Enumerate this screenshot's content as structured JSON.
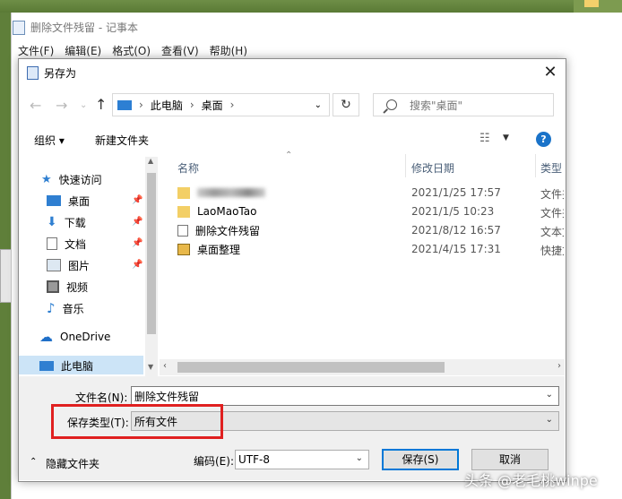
{
  "notepad": {
    "title": "删除文件残留 - 记事本",
    "menu": [
      "文件(F)",
      "编辑(E)",
      "格式(O)",
      "查看(V)",
      "帮助(H)"
    ]
  },
  "dialog": {
    "title": "另存为",
    "address": {
      "segments": [
        "此电脑",
        "桌面"
      ]
    },
    "search_placeholder": "搜索\"桌面\"",
    "toolbar": {
      "organize": "组织 ▾",
      "new_folder": "新建文件夹"
    },
    "nav": [
      {
        "label": "快速访问",
        "icon": "star-icon"
      },
      {
        "label": "桌面",
        "icon": "desktop-icon",
        "pinned": true
      },
      {
        "label": "下载",
        "icon": "download-icon",
        "pinned": true
      },
      {
        "label": "文档",
        "icon": "document-icon",
        "pinned": true
      },
      {
        "label": "图片",
        "icon": "picture-icon",
        "pinned": true
      },
      {
        "label": "视频",
        "icon": "video-icon"
      },
      {
        "label": "音乐",
        "icon": "music-icon"
      },
      {
        "label": "OneDrive",
        "icon": "cloud-icon"
      },
      {
        "label": "此电脑",
        "icon": "computer-icon",
        "selected": true
      }
    ],
    "columns": {
      "name": "名称",
      "modified": "修改日期",
      "type": "类型"
    },
    "files": [
      {
        "name": "",
        "modified": "2021/1/25 17:57",
        "type": "文件夹",
        "icon": "folder-icon"
      },
      {
        "name": "LaoMaoTao",
        "modified": "2021/1/5 10:23",
        "type": "文件夹",
        "icon": "folder-icon"
      },
      {
        "name": "删除文件残留",
        "modified": "2021/8/12 16:57",
        "type": "文本文档",
        "icon": "text-file-icon"
      },
      {
        "name": "桌面整理",
        "modified": "2021/4/15 17:31",
        "type": "快捷方式",
        "icon": "shortcut-icon"
      }
    ],
    "filename_label": "文件名(N):",
    "filename_value": "删除文件残留",
    "savetype_label": "保存类型(T):",
    "savetype_value": "所有文件",
    "encoding_label": "编码(E):",
    "encoding_value": "UTF-8",
    "hide_folders": "隐藏文件夹",
    "save_button": "保存(S)",
    "cancel_button": "取消"
  },
  "watermark": "头条 @老毛桃winpe",
  "colors": {
    "highlight": "#e02020",
    "accent": "#0078d7",
    "selected": "#cce4f7"
  }
}
